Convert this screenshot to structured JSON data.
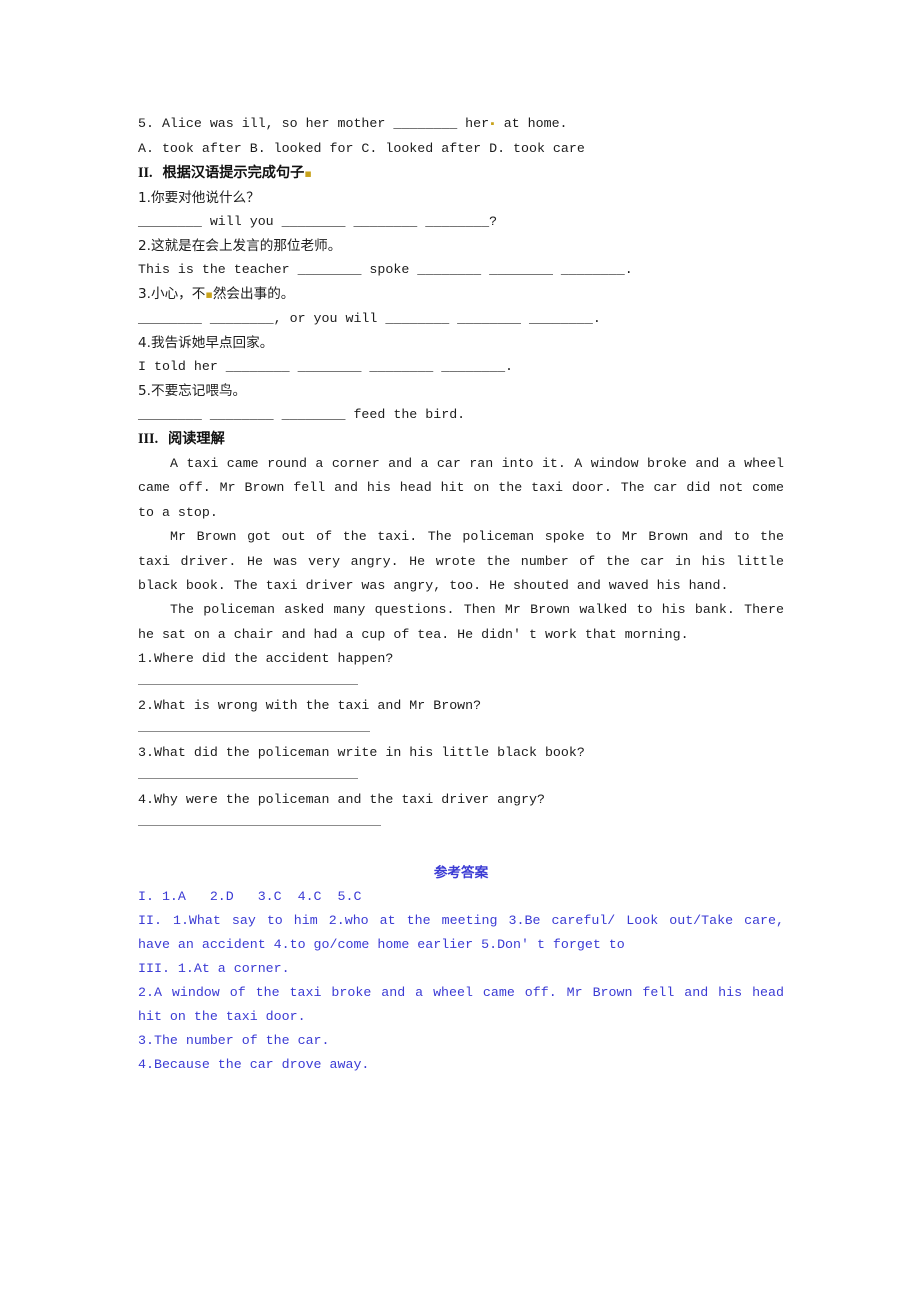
{
  "document": {
    "type": "worksheet",
    "section_one_tail": {
      "question5": "5. Alice was ill, so her mother ________ her",
      "question5_end": " at home.",
      "options5": "A. took after B. looked for C. looked after D. took care"
    },
    "section_two": {
      "heading_roman": "II.",
      "heading_cn": "根据汉语提示完成句子",
      "items": [
        {
          "prompt": "1.你要对他说什么？",
          "answer_line": "________ will you ________ ________ ________?"
        },
        {
          "prompt": "2.这就是在会上发言的那位老师。",
          "answer_line": "This is the teacher ________ spoke ________ ________ ________."
        },
        {
          "prompt_a": "3.小心，不",
          "prompt_b": "然会出事的。",
          "answer_line": "________ ________, or you will ________ ________ ________."
        },
        {
          "prompt": "4.我告诉她早点回家。",
          "answer_line": "I told her ________ ________ ________ ________."
        },
        {
          "prompt": "5.不要忘记喂鸟。",
          "answer_line": "________ ________ ________ feed the bird."
        }
      ]
    },
    "section_three": {
      "heading_roman": "III.",
      "heading_cn": "阅读理解",
      "passage": [
        "A taxi came round a corner and a car ran into it. A window broke and a wheel came off. Mr Brown fell and his head hit on the taxi door. The car did not come to a stop.",
        "Mr Brown got out of the taxi. The policeman spoke to Mr Brown and to the taxi driver. He was very angry. He wrote the number of the car in his little black book. The taxi driver was angry, too. He shouted and waved his hand.",
        "The policeman asked many questions. Then Mr Brown walked to his bank. There he sat on a chair and had a cup of tea. He didn' t work that morning."
      ],
      "questions": [
        "1.Where did the accident happen?",
        "2.What is wrong with the taxi and Mr Brown?",
        "3.What did the policeman write in his little black book?",
        "4.Why were the policeman and the taxi driver angry?"
      ]
    },
    "answer_key": {
      "title": "参考答案",
      "color": "#3b3bd4",
      "lines": [
        "I. 1.A   2.D   3.C  4.C  5.C",
        "II. 1.What say to him 2.who at the meeting 3.Be careful/ Look out/Take care, have an accident 4.to go/come home earlier 5.Don' t forget to",
        "III. 1.At a corner.",
        "2.A window of the taxi broke and a wheel came off. Mr Brown fell and his head hit on the taxi door.",
        "3.The number of the car.",
        "4.Because the car drove away."
      ]
    }
  }
}
